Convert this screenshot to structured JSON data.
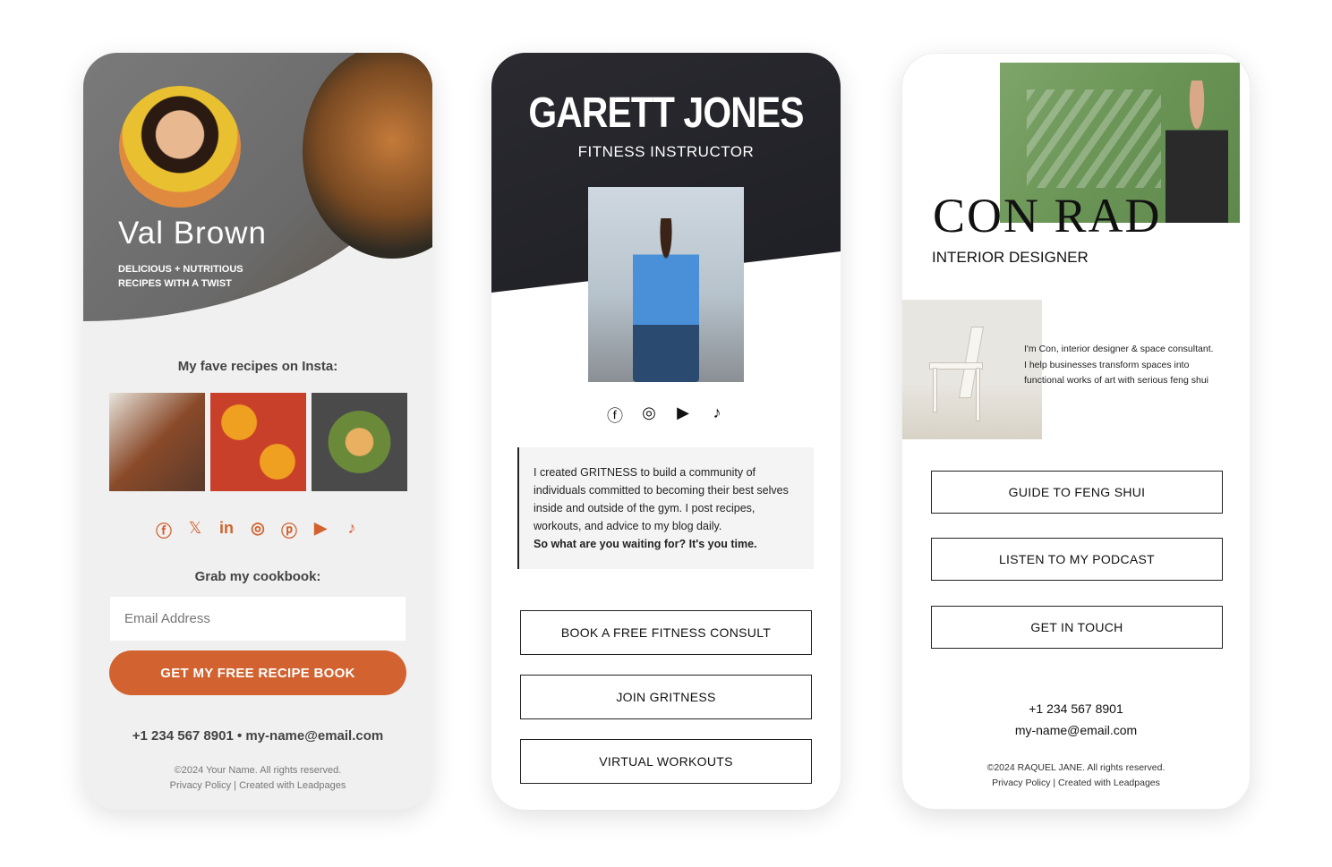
{
  "card1": {
    "name": "Val Brown",
    "tagline_line1": "DELICIOUS + NUTRITIOUS",
    "tagline_line2": "RECIPES WITH A TWIST",
    "insta_heading": "My fave recipes on Insta:",
    "social_icons": [
      "facebook-icon",
      "x-icon",
      "linkedin-icon",
      "instagram-icon",
      "pinterest-icon",
      "youtube-icon",
      "tiktok-icon"
    ],
    "cookbook_heading": "Grab my cookbook:",
    "email_placeholder": "Email Address",
    "cta_label": "GET MY FREE RECIPE BOOK",
    "contact": "+1 234 567 8901 • my-name@email.com",
    "copyright": "©2024 Your Name. All rights reserved.",
    "privacy": "Privacy Policy",
    "separator": "|",
    "created_with": "Created with Leadpages",
    "accent": "#d2622f"
  },
  "card2": {
    "name": "GARETT JONES",
    "role": "FITNESS INSTRUCTOR",
    "social_icons": [
      "facebook-icon",
      "instagram-icon",
      "youtube-icon",
      "tiktok-icon"
    ],
    "bio": "I created GRITNESS to build a community of individuals committed to becoming their best selves inside and outside of the gym. I post recipes, workouts, and advice to my blog daily.",
    "bio_bold": "So what are you waiting for? It's you time.",
    "buttons": [
      "BOOK A FREE FITNESS CONSULT",
      "JOIN GRITNESS",
      "VIRTUAL WORKOUTS"
    ]
  },
  "card3": {
    "name": "CON RAD",
    "role": "INTERIOR DESIGNER",
    "bio_line1": "I'm Con, interior designer & space consultant.",
    "bio_line2": "I help businesses transform spaces into",
    "bio_line3": "functional works of art with serious feng shui",
    "buttons": [
      "GUIDE TO FENG SHUI",
      "LISTEN TO MY PODCAST",
      "GET IN TOUCH"
    ],
    "phone": "+1 234 567 8901",
    "email": "my-name@email.com",
    "copyright": "©2024 RAQUEL JANE. All rights reserved.",
    "privacy": "Privacy Policy",
    "separator": "|",
    "created_with": "Created with Leadpages"
  }
}
